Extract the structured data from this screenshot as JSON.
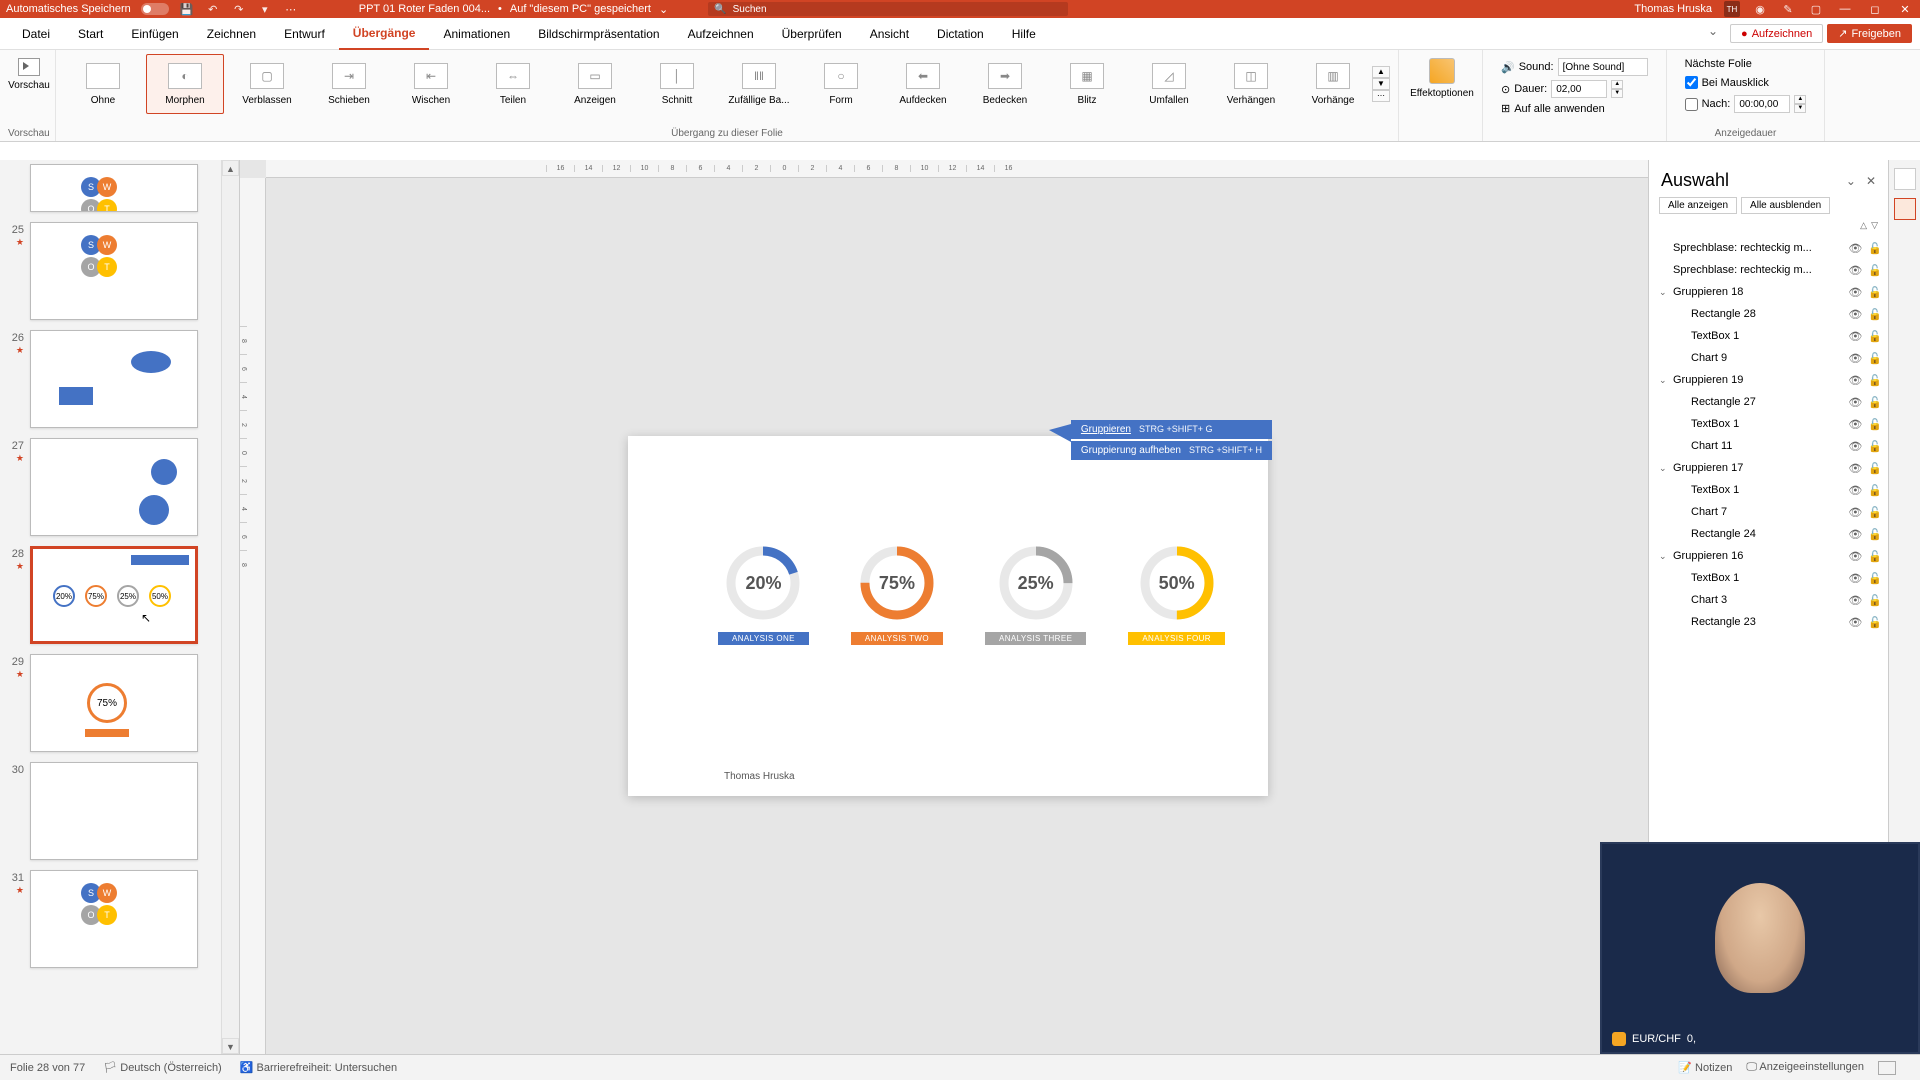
{
  "titlebar": {
    "autosave": "Automatisches Speichern",
    "filename": "PPT 01 Roter Faden 004...",
    "save_location": "Auf \"diesem PC\" gespeichert",
    "search_placeholder": "Suchen",
    "username": "Thomas Hruska",
    "initials": "TH"
  },
  "menu": {
    "tabs": [
      "Datei",
      "Start",
      "Einfügen",
      "Zeichnen",
      "Entwurf",
      "Übergänge",
      "Animationen",
      "Bildschirmpräsentation",
      "Aufzeichnen",
      "Überprüfen",
      "Ansicht",
      "Dictation",
      "Hilfe"
    ],
    "active": 5,
    "record": "Aufzeichnen",
    "share": "Freigeben"
  },
  "ribbon": {
    "preview": "Vorschau",
    "transitions": [
      {
        "label": "Ohne",
        "icon": ""
      },
      {
        "label": "Morphen",
        "icon": "◐"
      },
      {
        "label": "Verblassen",
        "icon": "▢"
      },
      {
        "label": "Schieben",
        "icon": "⇥"
      },
      {
        "label": "Wischen",
        "icon": "⇤"
      },
      {
        "label": "Teilen",
        "icon": "⇔"
      },
      {
        "label": "Anzeigen",
        "icon": "▭"
      },
      {
        "label": "Schnitt",
        "icon": "│"
      },
      {
        "label": "Zufällige Ba...",
        "icon": "‖‖"
      },
      {
        "label": "Form",
        "icon": "○"
      },
      {
        "label": "Aufdecken",
        "icon": "⬅"
      },
      {
        "label": "Bedecken",
        "icon": "➡"
      },
      {
        "label": "Blitz",
        "icon": "▦"
      },
      {
        "label": "Umfallen",
        "icon": "◿"
      },
      {
        "label": "Verhängen",
        "icon": "◫"
      },
      {
        "label": "Vorhänge",
        "icon": "▥"
      }
    ],
    "transitions_label": "Übergang zu dieser Folie",
    "effect_options": "Effektoptionen",
    "sound_label": "Sound:",
    "sound_value": "[Ohne Sound]",
    "duration_label": "Dauer:",
    "duration_value": "02,00",
    "apply_all": "Auf alle anwenden",
    "advance_label": "Nächste Folie",
    "on_click": "Bei Mausklick",
    "after_label": "Nach:",
    "after_value": "00:00,00",
    "timing_label": "Anzeigedauer"
  },
  "thumbs": [
    {
      "num": "",
      "star": false
    },
    {
      "num": "25",
      "star": true
    },
    {
      "num": "26",
      "star": true
    },
    {
      "num": "27",
      "star": true
    },
    {
      "num": "28",
      "star": true
    },
    {
      "num": "29",
      "star": true
    },
    {
      "num": "30",
      "star": false
    },
    {
      "num": "31",
      "star": true
    }
  ],
  "callouts": {
    "group": "Gruppieren",
    "group_kbd": "STRG +SHIFT+ G",
    "ungroup": "Gruppierung aufheben",
    "ungroup_kbd": "STRG +SHIFT+ H"
  },
  "chart_data": {
    "type": "pie",
    "series": [
      {
        "name": "ANALYSIS ONE",
        "value": 20,
        "color": "#4472c4"
      },
      {
        "name": "ANALYSIS TWO",
        "value": 75,
        "color": "#ed7d31"
      },
      {
        "name": "ANALYSIS THREE",
        "value": 25,
        "color": "#a5a5a5"
      },
      {
        "name": "ANALYSIS FOUR",
        "value": 50,
        "color": "#ffc000"
      }
    ],
    "title": "",
    "xlabel": "",
    "ylabel": "",
    "ylim": [
      0,
      100
    ]
  },
  "donuts": [
    {
      "pct": "20%",
      "label": "ANALYSIS ONE",
      "color": "#4472c4",
      "cls": "d1"
    },
    {
      "pct": "75%",
      "label": "ANALYSIS TWO",
      "color": "#ed7d31",
      "cls": "d2"
    },
    {
      "pct": "25%",
      "label": "ANALYSIS THREE",
      "color": "#a5a5a5",
      "cls": "d3"
    },
    {
      "pct": "50%",
      "label": "ANALYSIS FOUR",
      "color": "#ffc000",
      "cls": "d4"
    }
  ],
  "slide": {
    "author": "Thomas Hruska"
  },
  "selection": {
    "title": "Auswahl",
    "show_all": "Alle anzeigen",
    "hide_all": "Alle ausblenden",
    "items": [
      {
        "type": "item",
        "name": "Sprechblase: rechteckig m..."
      },
      {
        "type": "item",
        "name": "Sprechblase: rechteckig m..."
      },
      {
        "type": "group",
        "name": "Gruppieren 18"
      },
      {
        "type": "child",
        "name": "Rectangle 28"
      },
      {
        "type": "child",
        "name": "TextBox 1"
      },
      {
        "type": "child",
        "name": "Chart 9"
      },
      {
        "type": "group",
        "name": "Gruppieren 19"
      },
      {
        "type": "child",
        "name": "Rectangle 27"
      },
      {
        "type": "child",
        "name": "TextBox 1"
      },
      {
        "type": "child",
        "name": "Chart 11"
      },
      {
        "type": "group",
        "name": "Gruppieren 17"
      },
      {
        "type": "child",
        "name": "TextBox 1"
      },
      {
        "type": "child",
        "name": "Chart 7"
      },
      {
        "type": "child",
        "name": "Rectangle 24"
      },
      {
        "type": "group",
        "name": "Gruppieren 16"
      },
      {
        "type": "child",
        "name": "TextBox 1"
      },
      {
        "type": "child",
        "name": "Chart 3"
      },
      {
        "type": "child",
        "name": "Rectangle 23"
      }
    ]
  },
  "status": {
    "slide_info": "Folie 28 von 77",
    "language": "Deutsch (Österreich)",
    "accessibility": "Barrierefreiheit: Untersuchen",
    "notes": "Notizen",
    "display_settings": "Anzeigeeinstellungen",
    "currency": "EUR/CHF",
    "currency_val": "0,"
  }
}
